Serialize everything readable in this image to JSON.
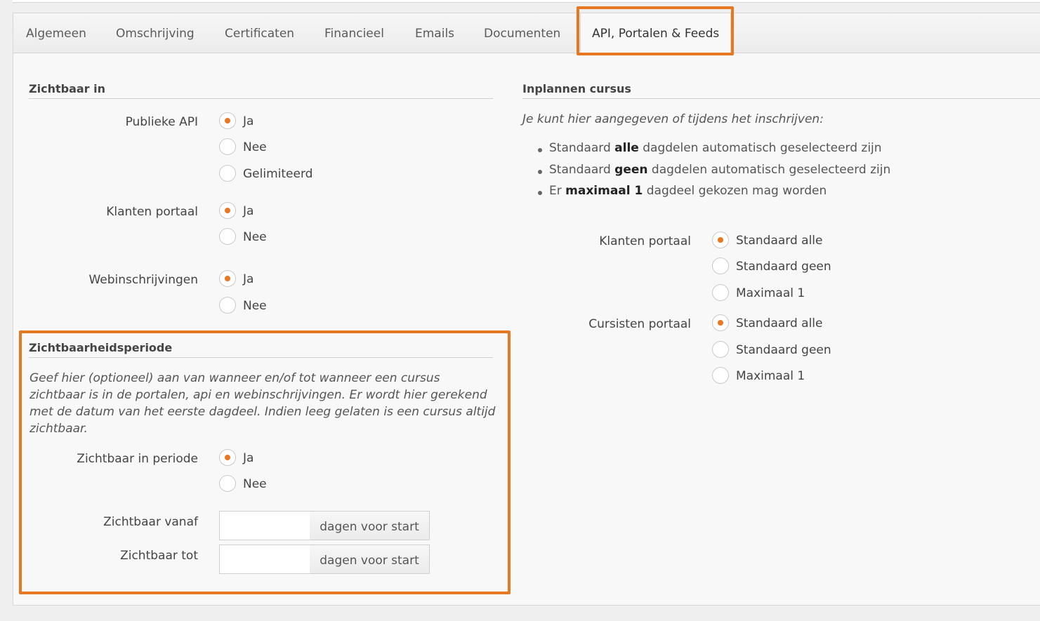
{
  "tabs": [
    {
      "label": "Algemeen"
    },
    {
      "label": "Omschrijving"
    },
    {
      "label": "Certificaten"
    },
    {
      "label": "Financieel"
    },
    {
      "label": "Emails"
    },
    {
      "label": "Documenten"
    },
    {
      "label": "API, Portalen & Feeds",
      "active": true
    }
  ],
  "visible": {
    "title": "Zichtbaar in",
    "publieke_api": {
      "label": "Publieke API",
      "options": [
        "Ja",
        "Nee",
        "Gelimiteerd"
      ],
      "selected": "Ja"
    },
    "klanten_portaal": {
      "label": "Klanten portaal",
      "options": [
        "Ja",
        "Nee"
      ],
      "selected": "Ja"
    },
    "webinschrijvingen": {
      "label": "Webinschrijvingen",
      "options": [
        "Ja",
        "Nee"
      ],
      "selected": "Ja"
    }
  },
  "period": {
    "title": "Zichtbaarheidsperiode",
    "description": "Geef hier (optioneel) aan van wanneer en/of tot wanneer een cursus zichtbaar is in de portalen, api en webinschrijvingen. Er wordt hier gerekend met de datum van het eerste dagdeel. Indien leeg gelaten is een cursus altijd zichtbaar.",
    "in_periode": {
      "label": "Zichtbaar in periode",
      "options": [
        "Ja",
        "Nee"
      ],
      "selected": "Ja"
    },
    "vanaf": {
      "label": "Zichtbaar vanaf",
      "value": "",
      "addon": "dagen voor start"
    },
    "tot": {
      "label": "Zichtbaar tot",
      "value": "",
      "addon": "dagen voor start"
    }
  },
  "plan": {
    "title": "Inplannen cursus",
    "intro": "Je kunt hier aangegeven of tijdens het inschrijven:",
    "bullets": [
      {
        "pre": "Standaard ",
        "bold": "alle",
        "post": " dagdelen automatisch geselecteerd zijn"
      },
      {
        "pre": "Standaard ",
        "bold": "geen",
        "post": " dagdelen automatisch geselecteerd zijn"
      },
      {
        "pre": "Er ",
        "bold": "maximaal 1",
        "post": " dagdeel gekozen mag worden"
      }
    ],
    "klanten_portaal": {
      "label": "Klanten portaal",
      "options": [
        "Standaard alle",
        "Standaard geen",
        "Maximaal 1"
      ],
      "selected": "Standaard alle"
    },
    "cursisten_portaal": {
      "label": "Cursisten portaal",
      "options": [
        "Standaard alle",
        "Standaard geen",
        "Maximaal 1"
      ],
      "selected": "Standaard alle"
    }
  },
  "colors": {
    "accent": "#e87722"
  }
}
